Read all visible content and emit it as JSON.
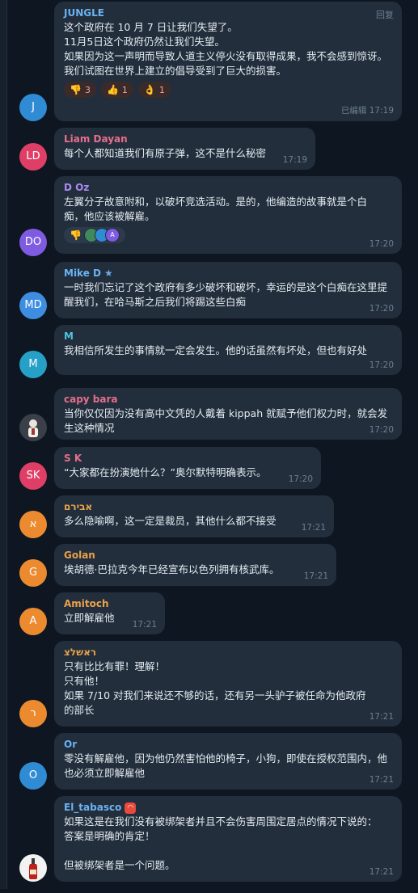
{
  "ui": {
    "reply_label": "回复"
  },
  "messages": [
    {
      "name": "JUNGLE",
      "name_color": "#6ab3f3",
      "avatar_letter": "J",
      "avatar_color": "#2f8bd3",
      "text": "这个政府在 10 月 7 日让我们失望了。\n11月5日这个政府仍然让我们失望。\n如果因为这一声明而导致人道主义停火没有取得成果，我不会感到惊讶。\n我们试图在世界上建立的倡导受到了巨大的损害。",
      "reactions": [
        {
          "emoji": "👎",
          "count": "3"
        },
        {
          "emoji": "👍",
          "count": "1"
        },
        {
          "emoji": "👌",
          "count": "1"
        }
      ],
      "edited": "已编辑",
      "time": "17:19"
    },
    {
      "name": "Liam Dayan",
      "name_color": "#e56f8c",
      "avatar_letter": "LD",
      "avatar_color": "#df3f66",
      "text": "每个人都知道我们有原子弹，这不是什么秘密",
      "time": "17:19"
    },
    {
      "name": "D Oz",
      "name_color": "#a88cf0",
      "avatar_letter": "DO",
      "avatar_color": "#7e5be0",
      "text": "左翼分子故意附和，以破坏竞选活动。是的，他编造的故事就是个白痴，他应该被解雇。",
      "reaction_emoji": "👎",
      "reaction_mini": [
        "A"
      ],
      "time": "17:20"
    },
    {
      "name": "Mike D",
      "name_color": "#6ab3f3",
      "avatar_letter": "MD",
      "avatar_color": "#3d8de0",
      "text": "一时我们忘记了这个政府有多少破坏和破坏，幸运的是这个白痴在这里提醒我们，在哈马斯之后我们将踢这些白痴",
      "time": "17:20"
    },
    {
      "name": "M",
      "name_color": "#4fc3e0",
      "avatar_letter": "M",
      "avatar_color": "#27a0c8",
      "text": "我相信所发生的事情就一定会发生。他的话虽然有坏处，但也有好处",
      "time": "17:20"
    },
    {
      "name": "capy bara",
      "name_color": "#e56f8c",
      "avatar_letter": "",
      "avatar_color": "#3a3f48",
      "text": "当你仅仅因为没有高中文凭的人戴着 kippah 就赋予他们权力时，就会发生这种情况",
      "time": "17:20"
    },
    {
      "name": "S K",
      "name_color": "#e56f8c",
      "avatar_letter": "SK",
      "avatar_color": "#df3f66",
      "text": "“大家都在扮演她什么？”奥尔默特明确表示。",
      "time": "17:20"
    },
    {
      "name": "אבירם",
      "name_color": "#e8a24c",
      "avatar_letter": "א",
      "avatar_color": "#ec8a2f",
      "text": "多么隐喻啊，这一定是裁员，其他什么都不接受",
      "time": "17:21"
    },
    {
      "name": "Golan",
      "name_color": "#e8a24c",
      "avatar_letter": "G",
      "avatar_color": "#ec8a2f",
      "text": "埃胡德·巴拉克今年已经宣布以色列拥有核武库。",
      "time": "17:21"
    },
    {
      "name": "Amitoch",
      "name_color": "#e8a24c",
      "avatar_letter": "A",
      "avatar_color": "#ec8a2f",
      "text": "立即解雇他",
      "time": "17:21"
    },
    {
      "name": "ראשלצ",
      "name_color": "#e8a24c",
      "avatar_letter": "ר",
      "avatar_color": "#ec8a2f",
      "text": "只有比比有罪！理解！\n只有他！\n如果 7/10 对我们来说还不够的话，还有另一头驴子被任命为他政府的部长",
      "time": "17:21"
    },
    {
      "name": "Or",
      "name_color": "#6ab3f3",
      "avatar_letter": "O",
      "avatar_color": "#2f8bd3",
      "text": "零没有解雇他，因为他仍然害怕他的椅子，小狗，即使在授权范围内，他也必须立即解雇他",
      "time": "17:21"
    },
    {
      "name": "El_tabasco",
      "name_color": "#6ab3f3",
      "avatar_letter": "",
      "avatar_color": "#f2f2f2",
      "text": "如果这是在我们没有被绑架者并且不会伤害周围定居点的情况下说的：\n答案是明确的肯定！\n\n但被绑架者是一个问题。",
      "time": "17:21"
    }
  ]
}
